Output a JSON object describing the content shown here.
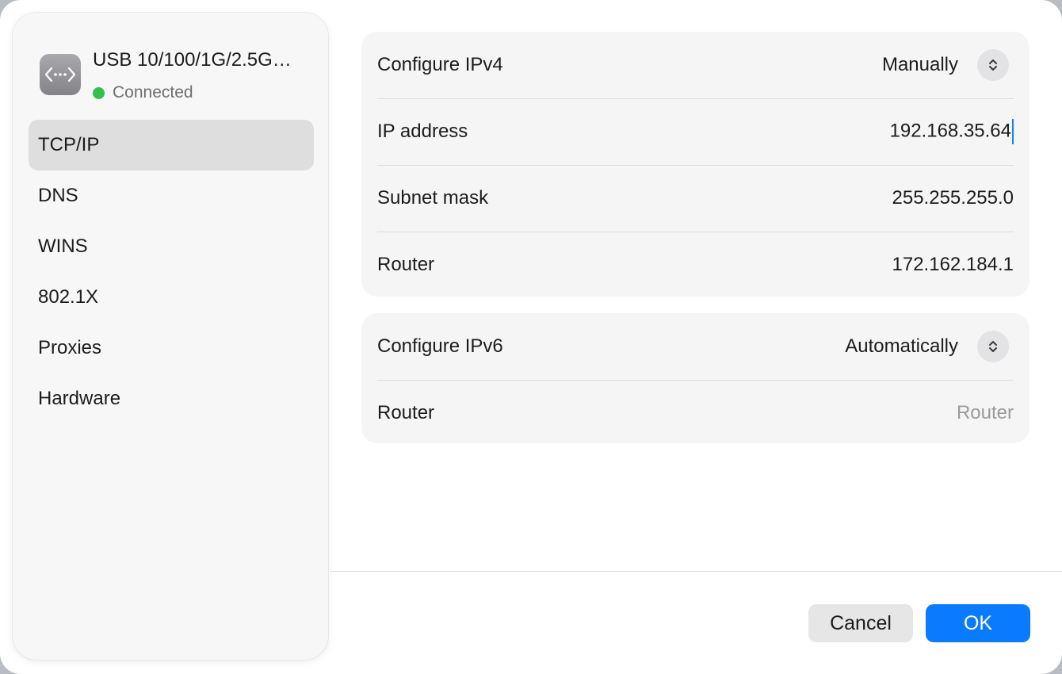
{
  "device": {
    "name": "USB 10/100/1G/2.5G…",
    "status": "Connected",
    "status_color": "#2fc24a"
  },
  "sidebar": {
    "items": [
      {
        "label": "TCP/IP",
        "selected": true
      },
      {
        "label": "DNS"
      },
      {
        "label": "WINS"
      },
      {
        "label": "802.1X"
      },
      {
        "label": "Proxies"
      },
      {
        "label": "Hardware"
      }
    ]
  },
  "ipv4": {
    "configure_label": "Configure IPv4",
    "configure_value": "Manually",
    "ip_label": "IP address",
    "ip_value": "192.168.35.64",
    "subnet_label": "Subnet mask",
    "subnet_value": "255.255.255.0",
    "router_label": "Router",
    "router_value": "172.162.184.1"
  },
  "ipv6": {
    "configure_label": "Configure IPv6",
    "configure_value": "Automatically",
    "router_label": "Router",
    "router_placeholder": "Router"
  },
  "buttons": {
    "cancel": "Cancel",
    "ok": "OK"
  },
  "colors": {
    "accent": "#0a7aff"
  }
}
